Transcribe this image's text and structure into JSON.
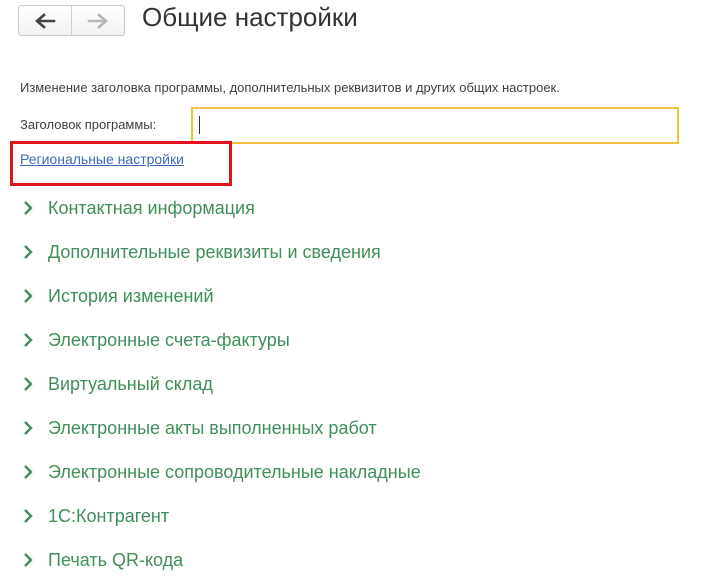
{
  "header": {
    "title": "Общие настройки",
    "back_icon": "arrow-left-icon",
    "forward_icon": "arrow-right-icon"
  },
  "form": {
    "description": "Изменение заголовка программы, дополнительных реквизитов и других общих настроек.",
    "program_title_label": "Заголовок программы:",
    "program_title_value": "",
    "regional_settings_link": "Региональные настройки"
  },
  "sections": [
    {
      "label": "Контактная информация"
    },
    {
      "label": "Дополнительные реквизиты и сведения"
    },
    {
      "label": "История изменений"
    },
    {
      "label": "Электронные счета-фактуры"
    },
    {
      "label": "Виртуальный склад"
    },
    {
      "label": "Электронные акты выполненных работ"
    },
    {
      "label": "Электронные сопроводительные накладные"
    },
    {
      "label": "1С:Контрагент"
    },
    {
      "label": "Печать QR-кода"
    }
  ],
  "colors": {
    "section_green": "#3f8f58",
    "link_blue": "#3b6bb8",
    "input_focus_border": "#f0c23c",
    "highlight_red": "#e0121c"
  }
}
